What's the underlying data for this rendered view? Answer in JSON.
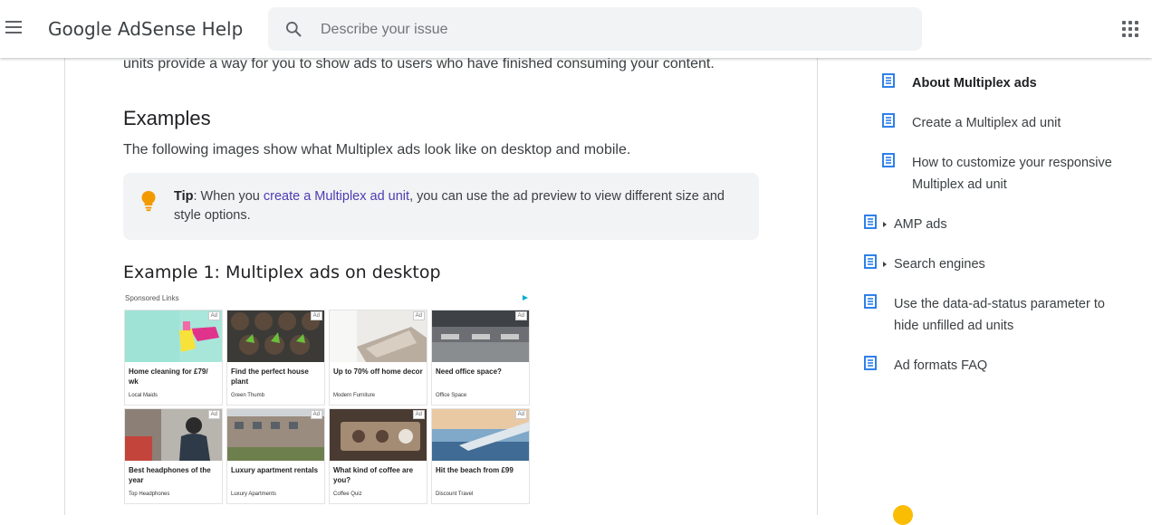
{
  "header": {
    "title": "Google AdSense Help",
    "search_placeholder": "Describe your issue",
    "menu_icon": "hamburger-menu-icon",
    "apps_icon": "apps-grid-icon"
  },
  "article": {
    "intro_text": "units provide a way for you to show ads to users who have finished consuming your content.",
    "examples_heading": "Examples",
    "examples_desc": "The following images show what Multiplex ads look like on desktop and mobile.",
    "tip": {
      "label": "Tip",
      "before": ": When you ",
      "link": "create a Multiplex ad unit",
      "after": ", you can use the ad preview to view different size and style options."
    },
    "example1_heading": "Example 1: Multiplex ads on desktop"
  },
  "ad_preview": {
    "sponsored_label": "Sponsored Links",
    "badge": "Ad",
    "ads": [
      {
        "title": "Home cleaning for £79/ wk",
        "source": "Local Maids"
      },
      {
        "title": "Find the perfect house plant",
        "source": "Green Thumb"
      },
      {
        "title": "Up to 70% off home decor",
        "source": "Modern Furniture"
      },
      {
        "title": "Need office space?",
        "source": "Office Space"
      },
      {
        "title": "Best headphones of the year",
        "source": "Top Headphones"
      },
      {
        "title": "Luxury apartment rentals",
        "source": "Luxury Apartments"
      },
      {
        "title": "What kind of coffee are you?",
        "source": "Coffee Quiz"
      },
      {
        "title": "Hit the beach from £99",
        "source": "Discount Travel"
      }
    ]
  },
  "sidebar": {
    "items": [
      {
        "label": "About Multiplex ads",
        "active": true
      },
      {
        "label": "Create a Multiplex ad unit"
      },
      {
        "label_line1": "How to customize your responsive",
        "label_line2": "Multiplex ad unit"
      },
      {
        "label": "AMP ads"
      },
      {
        "label": "Search engines"
      },
      {
        "label_line1": "Use the data-ad-status parameter to",
        "label_line2": "hide unfilled ad units"
      },
      {
        "label": "Ad formats FAQ"
      }
    ]
  },
  "colors": {
    "link": "#4f3bb5",
    "icon_blue": "#1a73e8",
    "tip_bulb": "#f29900",
    "tip_bg": "#f1f3f4",
    "fab": "#fbbc04"
  }
}
